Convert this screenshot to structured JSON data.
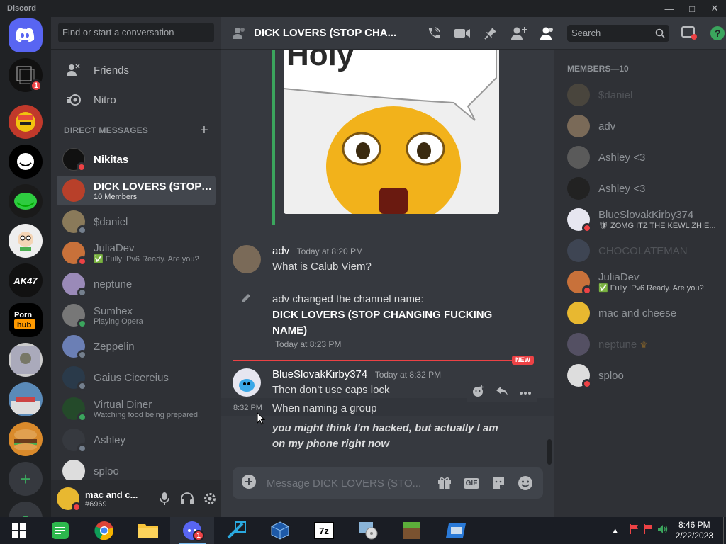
{
  "window": {
    "title": "Discord"
  },
  "dm_sidebar": {
    "search_placeholder": "Find or start a conversation",
    "friends_label": "Friends",
    "nitro_label": "Nitro",
    "dm_header": "DIRECT MESSAGES",
    "dms": [
      {
        "name": "Nikitas",
        "sub": "",
        "status": "dnd"
      },
      {
        "name": "DICK LOVERS (STOP ...",
        "sub": "10 Members",
        "status": ""
      },
      {
        "name": "$daniel",
        "sub": "",
        "status": "offline"
      },
      {
        "name": "JuliaDev",
        "sub": "✅ Fully IPv6 Ready. Are you?",
        "status": "dnd"
      },
      {
        "name": "neptune",
        "sub": "",
        "status": "offline"
      },
      {
        "name": "Sumhex",
        "sub": "Playing Opera",
        "status": "online"
      },
      {
        "name": "Zeppelin",
        "sub": "",
        "status": "offline"
      },
      {
        "name": "Gaius Cicereius",
        "sub": "",
        "status": "offline"
      },
      {
        "name": "Virtual Diner",
        "sub": "Watching food being prepared!",
        "status": "online"
      },
      {
        "name": "Ashley",
        "sub": "",
        "status": "offline"
      },
      {
        "name": "sploo",
        "sub": "",
        "status": ""
      }
    ],
    "user": {
      "name": "mac and c...",
      "tag": "#6969"
    }
  },
  "rail": {
    "unread_badge": "1"
  },
  "header": {
    "channel_title": "DICK LOVERS (STOP CHA...",
    "search_placeholder": "Search"
  },
  "messages": {
    "image_text": "Holy",
    "m1": {
      "author": "adv",
      "time": "Today at 8:20 PM",
      "text": "What is Calub Viem?"
    },
    "sys": {
      "prefix": "adv changed the channel name:",
      "name": "DICK LOVERS (STOP CHANGING FUCKING NAME)",
      "time": "Today at 8:23 PM"
    },
    "new_label": "NEW",
    "m2": {
      "author": "BlueSlovakKirby374",
      "time": "Today at 8:32 PM",
      "line1": "Then don't use caps lock",
      "hover_time": "8:32 PM",
      "line2": "When naming a group",
      "line3": "you might think I'm hacked, but actually I am on my phone right now"
    }
  },
  "composer": {
    "placeholder": "Message DICK LOVERS (STO...",
    "gif_label": "GIF"
  },
  "members": {
    "header": "MEMBERS—10",
    "list": [
      {
        "name": "$daniel",
        "sub": "",
        "status": "",
        "off": true
      },
      {
        "name": "adv",
        "sub": "",
        "status": "",
        "off": false
      },
      {
        "name": "Ashley <3",
        "sub": "",
        "status": "",
        "off": false
      },
      {
        "name": "Ashley <3",
        "sub": "",
        "status": "",
        "off": false
      },
      {
        "name": "BlueSlovakKirby374",
        "sub": "🛡 ZOMG ITZ THE KEWL ZHIE...",
        "status": "dnd",
        "off": false
      },
      {
        "name": "CHOCOLATEMAN",
        "sub": "",
        "status": "",
        "off": true
      },
      {
        "name": "JuliaDev",
        "sub": "✅ Fully IPv6 Ready. Are you?",
        "status": "dnd",
        "off": false
      },
      {
        "name": "mac and cheese",
        "sub": "",
        "status": "",
        "off": false
      },
      {
        "name": "neptune",
        "sub": "",
        "status": "",
        "off": true
      },
      {
        "name": "sploo",
        "sub": "",
        "status": "dnd",
        "off": false
      }
    ]
  },
  "taskbar": {
    "time": "8:46 PM",
    "date": "2/22/2023",
    "discord_badge": "1",
    "sevenzip_label": "7z"
  },
  "colors": {
    "accent": "#5865f2",
    "dnd": "#ed4245",
    "online": "#3ba55d",
    "green_bar": "#3ba55d",
    "new_red": "#ed4245"
  }
}
